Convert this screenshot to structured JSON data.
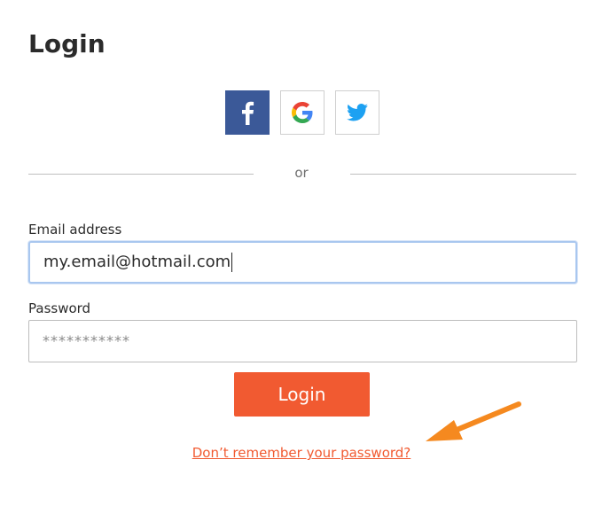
{
  "header": {
    "title": "Login"
  },
  "social": {
    "facebook_icon": "facebook-icon",
    "google_icon": "google-icon",
    "twitter_icon": "twitter-icon",
    "facebook_color": "#3b5998",
    "twitter_color": "#1da1f2"
  },
  "divider": {
    "text": "or"
  },
  "form": {
    "email_label": "Email address",
    "email_value": "my.email@hotmail.com",
    "password_label": "Password",
    "password_value": "***********",
    "login_label": "Login",
    "forgot_label": "Don’t remember your password?"
  },
  "colors": {
    "accent": "#f15a31",
    "annotation_arrow": "#f5891f",
    "focus_border": "#a9c7ef"
  }
}
